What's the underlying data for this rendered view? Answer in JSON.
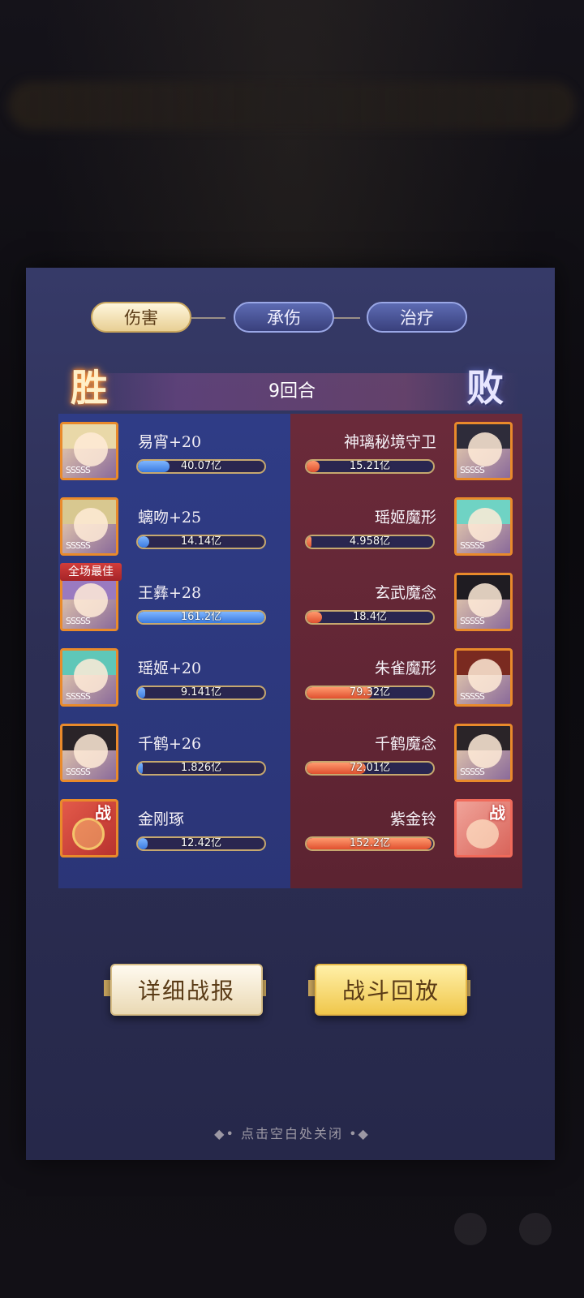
{
  "tabs": [
    {
      "label": "伤害",
      "active": true
    },
    {
      "label": "承伤",
      "active": false
    },
    {
      "label": "治疗",
      "active": false
    }
  ],
  "header": {
    "win_label": "胜",
    "lose_label": "败",
    "rounds": "9回合"
  },
  "best_badge": "全场最佳",
  "left_team": [
    {
      "name": "易宵+20",
      "value": "40.07亿",
      "fill": 0.25,
      "stars": "SSSSS"
    },
    {
      "name": "螭吻+25",
      "value": "14.14亿",
      "fill": 0.09,
      "stars": "SSSSS"
    },
    {
      "name": "王彝+28",
      "value": "161.2亿",
      "fill": 1.0,
      "stars": "SSSSS"
    },
    {
      "name": "瑶姬+20",
      "value": "9.141亿",
      "fill": 0.06,
      "stars": "SSSSS"
    },
    {
      "name": "千鹤+26",
      "value": "1.826亿",
      "fill": 0.02,
      "stars": "SSSSS"
    },
    {
      "name": "金刚琢",
      "value": "12.42亿",
      "fill": 0.08,
      "badge": "战"
    }
  ],
  "right_team": [
    {
      "name": "神璃秘境守卫",
      "value": "15.21亿",
      "fill": 0.1,
      "stars": "SSSSS"
    },
    {
      "name": "瑶姬魔形",
      "value": "4.958亿",
      "fill": 0.03,
      "stars": "SSSSS"
    },
    {
      "name": "玄武魔念",
      "value": "18.4亿",
      "fill": 0.12,
      "stars": "SSSSS"
    },
    {
      "name": "朱雀魔形",
      "value": "79.32亿",
      "fill": 0.52,
      "stars": "SSSSS"
    },
    {
      "name": "千鹤魔念",
      "value": "72.01亿",
      "fill": 0.47,
      "stars": "SSSSS"
    },
    {
      "name": "紫金铃",
      "value": "152.2亿",
      "fill": 0.99,
      "badge": "战"
    }
  ],
  "buttons": {
    "detail": "详细战报",
    "replay": "战斗回放"
  },
  "close_hint": "◆• 点击空白处关闭 •◆"
}
